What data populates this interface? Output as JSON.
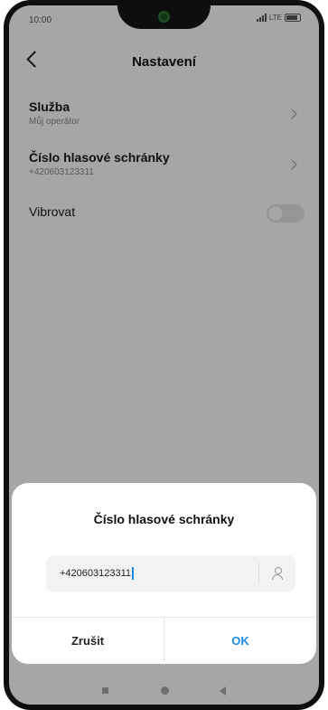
{
  "status_bar": {
    "time": "10:00",
    "network": "LTE"
  },
  "header": {
    "title": "Nastavení"
  },
  "settings": {
    "items": [
      {
        "title": "Služba",
        "subtitle": "Můj operátor"
      },
      {
        "title": "Číslo hlasové schránky",
        "subtitle": "+420603123311"
      },
      {
        "title": "Vibrovat"
      }
    ],
    "vibrate_enabled": false
  },
  "dialog": {
    "title": "Číslo hlasové schránky",
    "field_value": "+420603123311",
    "cancel_label": "Zrušit",
    "ok_label": "OK"
  },
  "colors": {
    "accent": "#1e88e5",
    "scrim": "rgba(0,0,0,0.35)"
  },
  "icons": [
    "back-icon",
    "chevron-right-icon",
    "contact-icon",
    "recent-apps-icon",
    "home-icon",
    "nav-back-icon"
  ]
}
